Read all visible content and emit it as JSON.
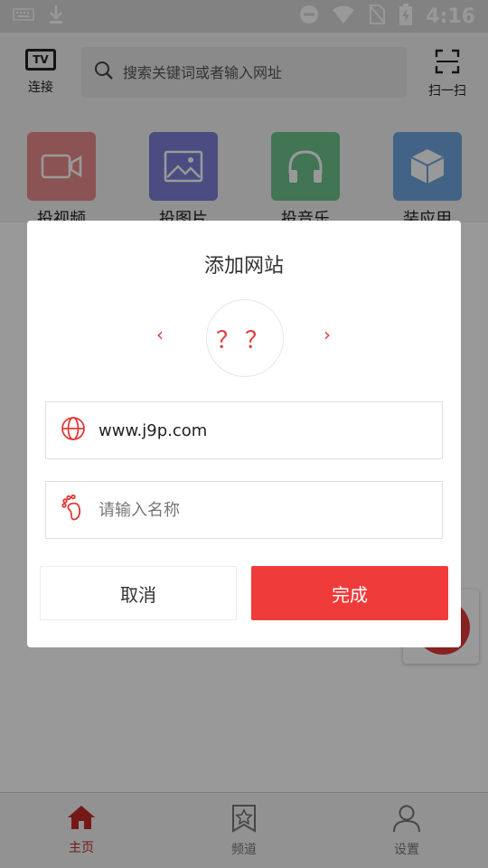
{
  "status": {
    "time": "4:16"
  },
  "header": {
    "tv_label": "连接",
    "tv_badge": "TV",
    "search_placeholder": "搜索关键词或者输入网址",
    "scan_label": "扫一扫"
  },
  "tiles": [
    {
      "label": "投视频",
      "icon": "video-camera-icon",
      "color": "#e88a8a"
    },
    {
      "label": "投图片",
      "icon": "image-icon",
      "color": "#7e7fd8"
    },
    {
      "label": "投音乐",
      "icon": "headphones-icon",
      "color": "#6dc38d"
    },
    {
      "label": "装应用",
      "icon": "box-icon",
      "color": "#6fa6e0"
    }
  ],
  "dialog": {
    "title": "添加网站",
    "prev": "‹",
    "next": "›",
    "icon_text": "？？",
    "url_value": "www.j9p.com",
    "name_placeholder": "请输入名称",
    "cancel_label": "取消",
    "done_label": "完成"
  },
  "tabbar": {
    "items": [
      {
        "label": "主页",
        "active": true
      },
      {
        "label": "频道",
        "active": false
      },
      {
        "label": "设置",
        "active": false
      }
    ]
  },
  "colors": {
    "accent": "#ef3b3a",
    "tab_active": "#c62828"
  }
}
